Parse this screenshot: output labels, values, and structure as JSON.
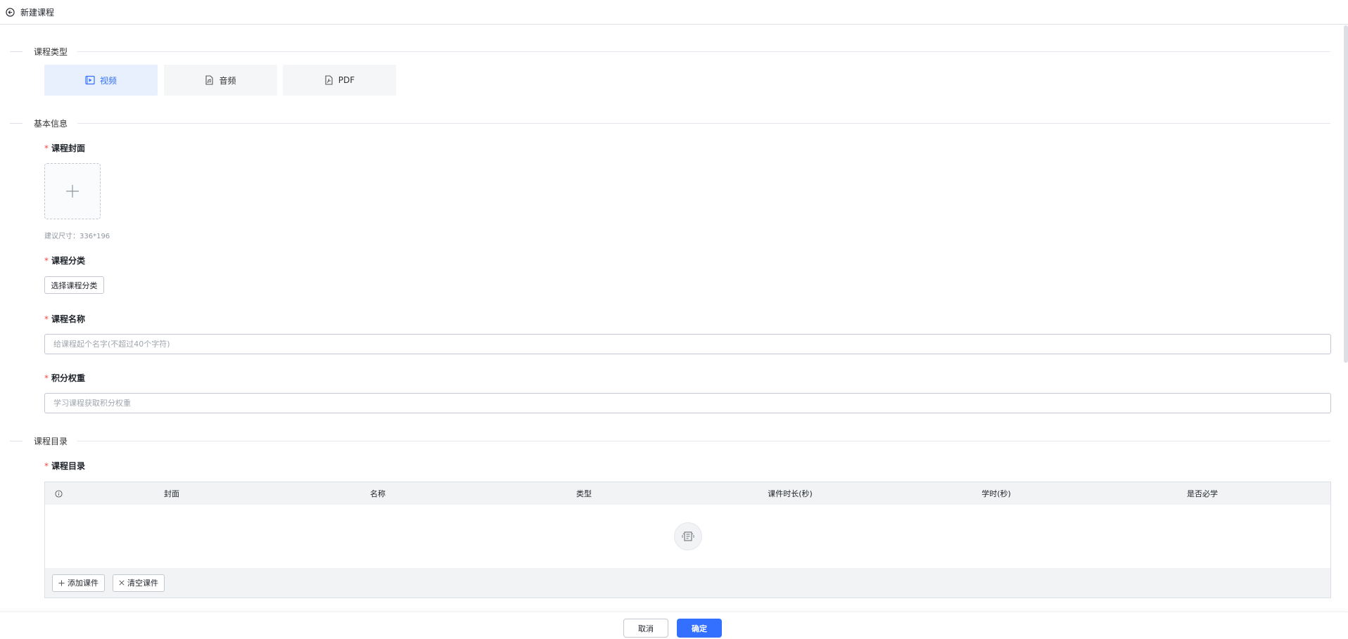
{
  "header": {
    "title": "新建课程"
  },
  "sections": {
    "course_type": "课程类型",
    "basic_info": "基本信息",
    "catalog": "课程目录"
  },
  "course_types": [
    {
      "label": "视频",
      "icon": "video-icon",
      "active": true
    },
    {
      "label": "音频",
      "icon": "audio-file-icon",
      "active": false
    },
    {
      "label": "PDF",
      "icon": "pdf-file-icon",
      "active": false
    }
  ],
  "fields": {
    "cover": {
      "label": "课程封面",
      "hint": "建议尺寸：336*196"
    },
    "category": {
      "label": "课程分类",
      "button": "选择课程分类"
    },
    "name": {
      "label": "课程名称",
      "placeholder": "给课程起个名字(不超过40个字符)",
      "value": ""
    },
    "weight": {
      "label": "积分权重",
      "placeholder": "学习课程获取积分权重",
      "value": ""
    },
    "catalog": {
      "label": "课程目录"
    }
  },
  "table": {
    "columns": [
      "封面",
      "名称",
      "类型",
      "课件时长(秒)",
      "学时(秒)",
      "是否必学"
    ],
    "rows": [],
    "add_button": "添加课件",
    "clear_button": "清空课件"
  },
  "footer": {
    "cancel": "取消",
    "confirm": "确定"
  },
  "colors": {
    "primary": "#3370ff",
    "required": "#f54a45",
    "active_bg": "#e8effd"
  }
}
